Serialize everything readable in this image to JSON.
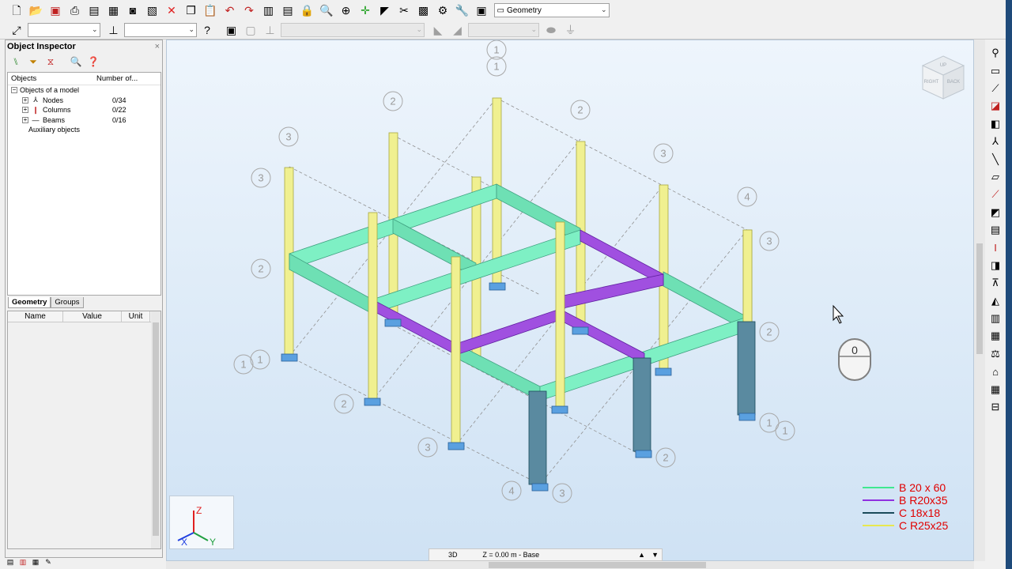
{
  "toolbar1": {
    "icons": [
      "new-icon",
      "open-icon",
      "save-icon",
      "print-icon",
      "print-preview-icon",
      "print-screen-icon",
      "screen-capture-icon",
      "paste-icon",
      "delete-icon",
      "copy-icon",
      "clipboard-icon",
      "undo-icon",
      "redo-icon",
      "tables-icon",
      "properties-icon",
      "lock-icon",
      "zoom-icon",
      "zoom-window-icon",
      "node-icon",
      "member-icon",
      "cut-icon",
      "group-icon",
      "settings-icon",
      "tools-icon"
    ],
    "layout_combo_value": "Geometry"
  },
  "toolbar2": {
    "combo1_value": "",
    "combo2_value": "",
    "combo3_value": "",
    "combo4_value": ""
  },
  "object_inspector": {
    "title": "Object Inspector",
    "columns": [
      "Objects",
      "Number of..."
    ],
    "root_label": "Objects of a model",
    "items": [
      {
        "label": "Nodes",
        "count": "0/34"
      },
      {
        "label": "Columns",
        "count": "0/22"
      },
      {
        "label": "Beams",
        "count": "0/16"
      }
    ],
    "auxiliary_label": "Auxiliary objects",
    "tabs": [
      "Geometry",
      "Groups"
    ],
    "prop_columns": [
      "Name",
      "Value",
      "Unit"
    ]
  },
  "viewport": {
    "view_mode": "3D",
    "level": "Z = 0.00 m - Base",
    "axis_labels": {
      "z": "Z",
      "x": "X",
      "y": "Y"
    },
    "viewcube": {
      "left": "RIGHT",
      "right": "BACK",
      "top": "UP"
    },
    "mouse_label": "0",
    "grid_labels_1": "1",
    "grid_labels_2": "2",
    "grid_labels_3": "3",
    "grid_labels_4": "4"
  },
  "legend": [
    {
      "label": "B 20 x 60",
      "color": "#40e890"
    },
    {
      "label": "B R20x35",
      "color": "#9030e0"
    },
    {
      "label": "C 18x18",
      "color": "#1a4a5a"
    },
    {
      "label": "C R25x25",
      "color": "#e8e850"
    }
  ],
  "colors": {
    "beam_green": "#7ef0c4",
    "beam_purple": "#a050e0",
    "column_yellow": "#f0f090",
    "column_dark": "#5a8aa0",
    "support_blue": "#5aa0e0"
  }
}
